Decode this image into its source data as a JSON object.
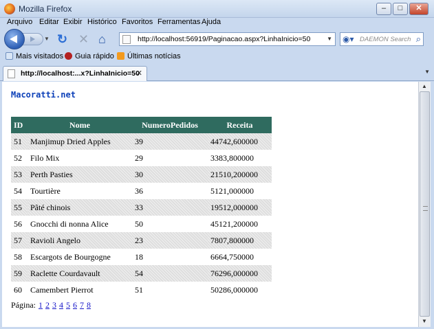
{
  "window": {
    "title": "Mozilla Firefox"
  },
  "menu": [
    "Arquivo",
    "Editar",
    "Exibir",
    "Histórico",
    "Favoritos",
    "Ferramentas",
    "Ajuda"
  ],
  "navbar": {
    "url": "http://localhost:56919/Paginacao.aspx?LinhaInicio=50",
    "search_placeholder": "DAEMON Search"
  },
  "bookmarks": [
    "Mais visitados",
    "Guia rápido",
    "Últimas notícias"
  ],
  "tab": {
    "title": "http://localhost:...x?LinhaInicio=50"
  },
  "page": {
    "site_title": "Macoratti.net",
    "table": {
      "headers": [
        "ID",
        "Nome",
        "NumeroPedidos",
        "Receita"
      ],
      "rows": [
        [
          "51",
          "Manjimup Dried Apples",
          "39",
          "44742,600000"
        ],
        [
          "52",
          "Filo Mix",
          "29",
          "3383,800000"
        ],
        [
          "53",
          "Perth Pasties",
          "30",
          "21510,200000"
        ],
        [
          "54",
          "Tourtière",
          "36",
          "5121,000000"
        ],
        [
          "55",
          "Pâté chinois",
          "33",
          "19512,000000"
        ],
        [
          "56",
          "Gnocchi di nonna Alice",
          "50",
          "45121,200000"
        ],
        [
          "57",
          "Ravioli Angelo",
          "23",
          "7807,800000"
        ],
        [
          "58",
          "Escargots de Bourgogne",
          "18",
          "6664,750000"
        ],
        [
          "59",
          "Raclette Courdavault",
          "54",
          "76296,000000"
        ],
        [
          "60",
          "Camembert Pierrot",
          "51",
          "50286,000000"
        ]
      ]
    },
    "pager": {
      "label": "Página:",
      "pages": [
        "1",
        "2",
        "3",
        "4",
        "5",
        "6",
        "7",
        "8"
      ]
    }
  }
}
